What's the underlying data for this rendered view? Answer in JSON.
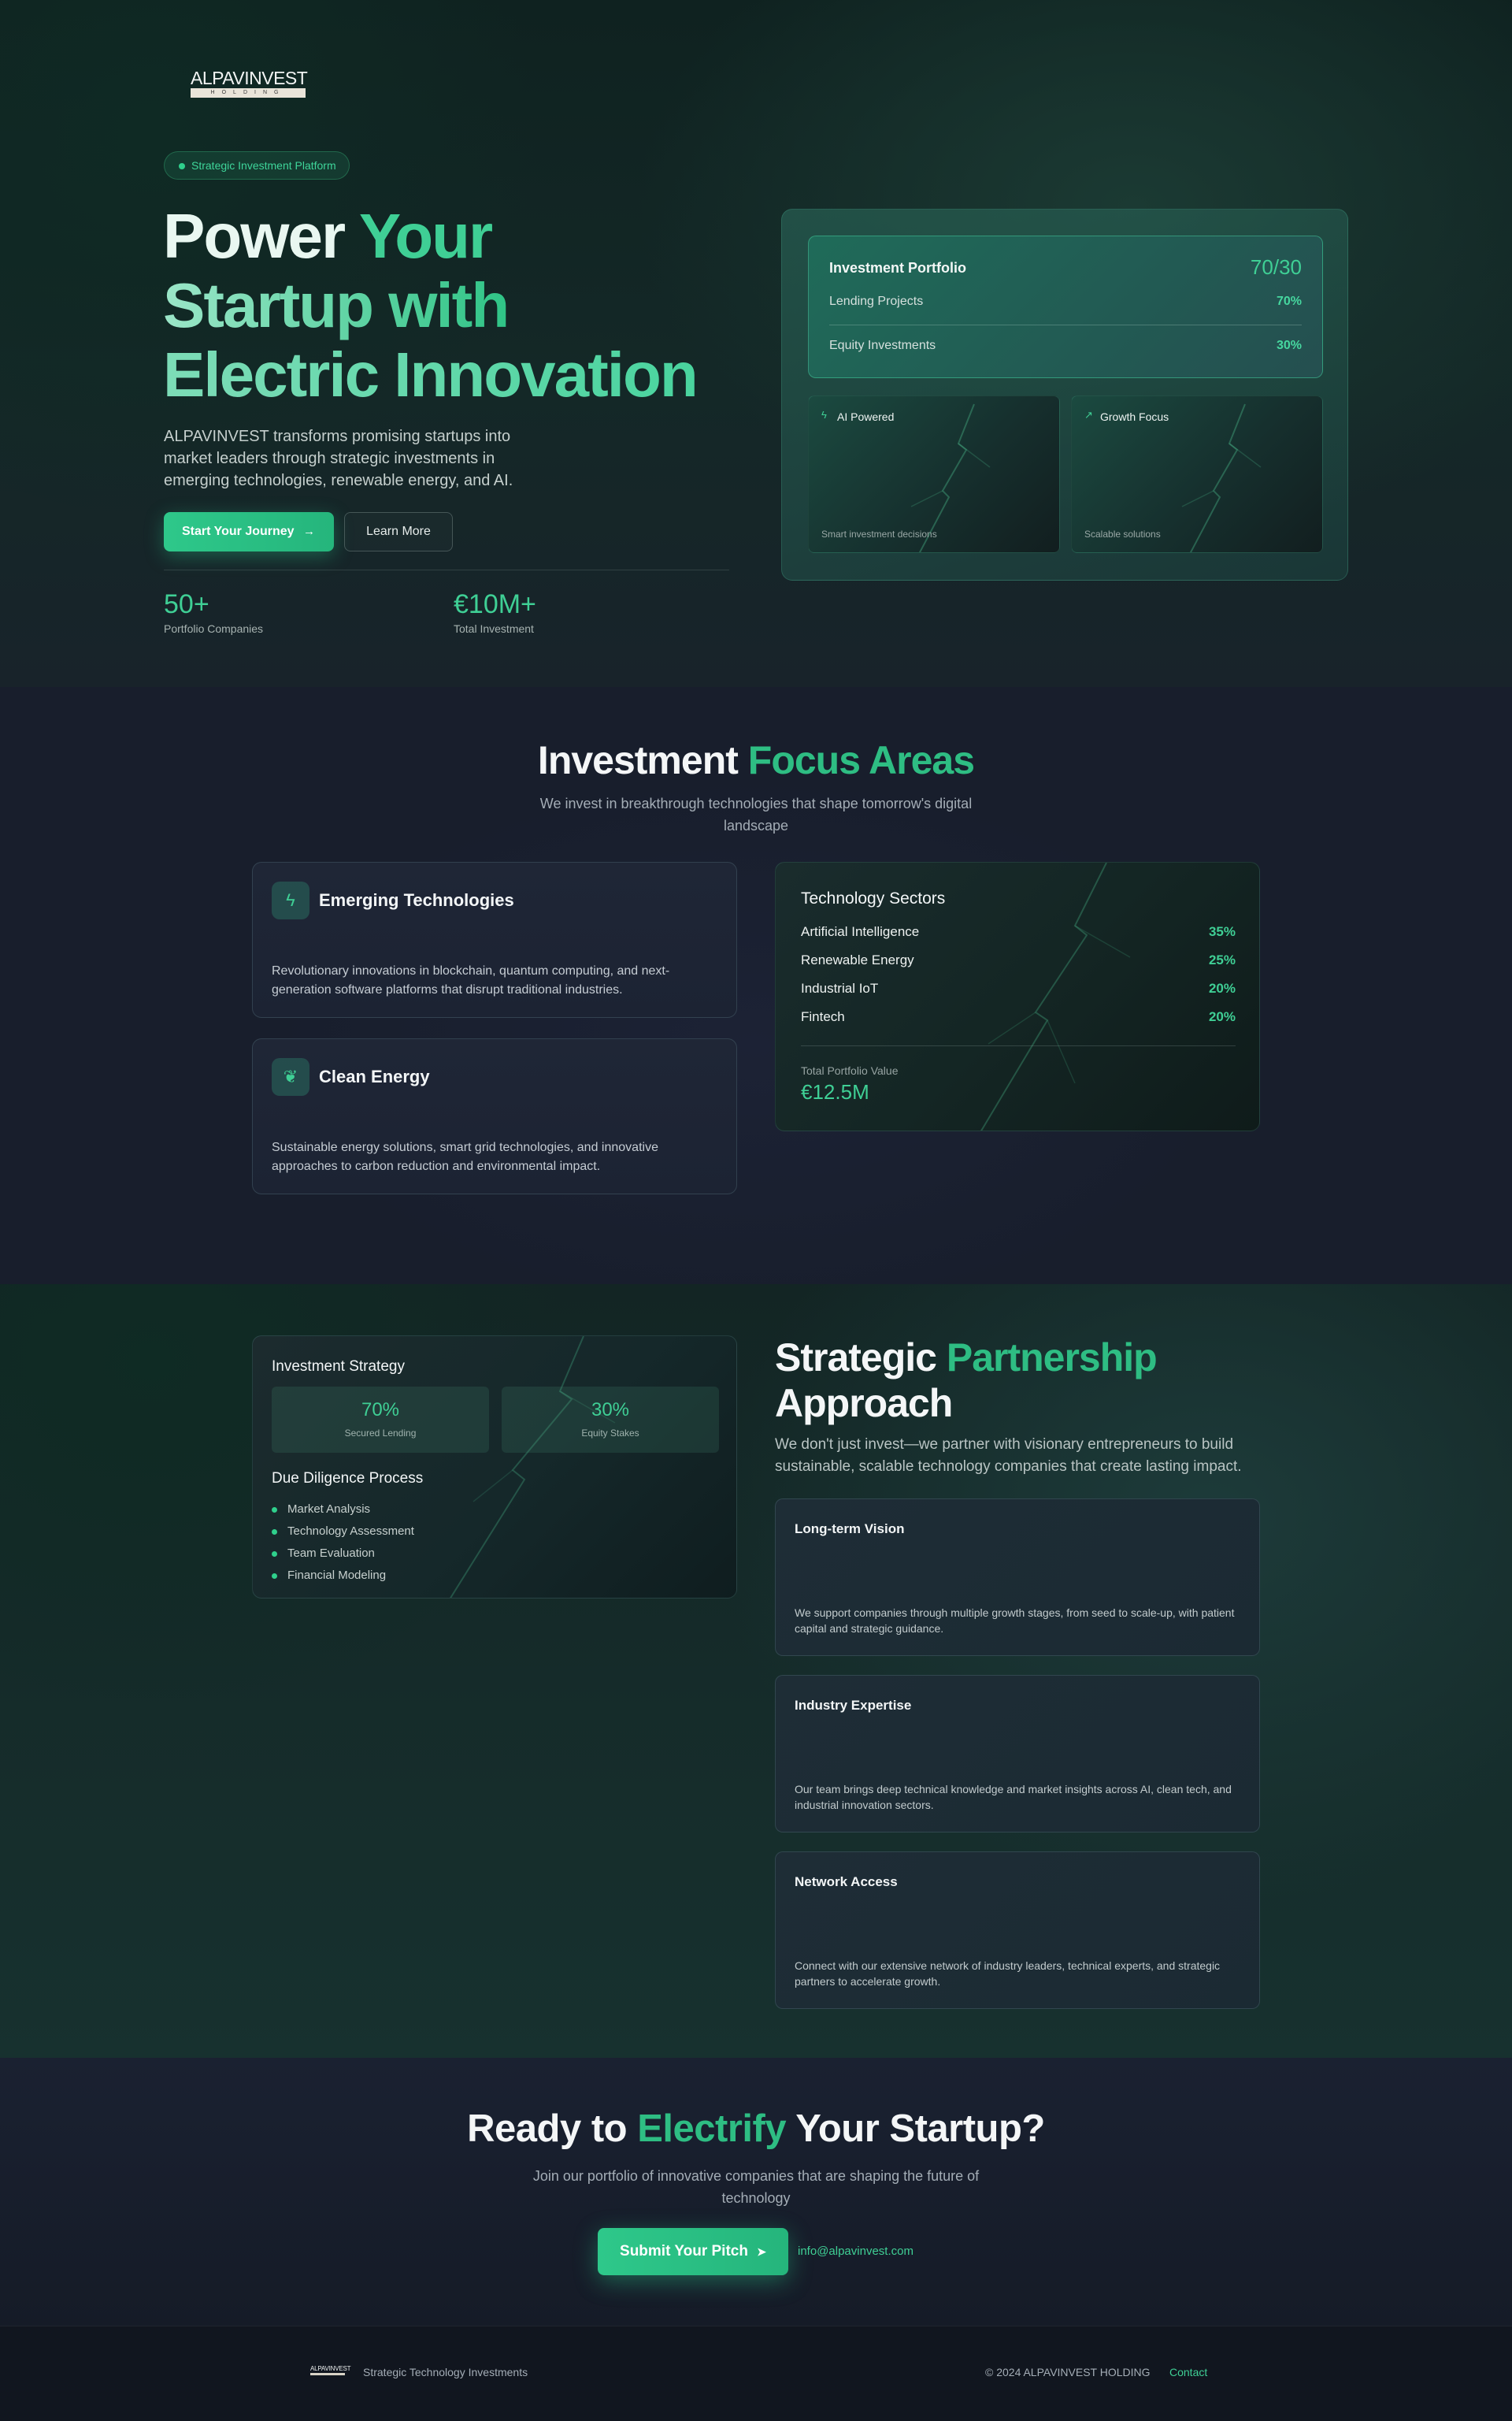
{
  "brand": {
    "logo_word": "ALPAVINVEST",
    "logo_sub": "HOLDING"
  },
  "hero": {
    "badge": "Strategic Investment Platform",
    "title_line1_a": "Power ",
    "title_line1_b": "Your",
    "title_line2": "Startup with",
    "title_line3": "Electric Innovation",
    "description": "ALPAVINVEST transforms promising startups into market leaders through strategic investments in emerging technologies, renewable energy, and AI.",
    "primary_button": "Start Your Journey",
    "primary_arrow": "→",
    "secondary_button": "Learn More",
    "stats": [
      {
        "value": "50+",
        "label": "Portfolio Companies"
      },
      {
        "value": "€10M+",
        "label": "Total Investment"
      }
    ]
  },
  "portfolio": {
    "title": "Investment Portfolio",
    "ratio": "70/30",
    "rows": [
      {
        "label": "Lending Projects",
        "value": "70%"
      },
      {
        "label": "Equity Investments",
        "value": "30%"
      }
    ],
    "tiles": [
      {
        "icon": "lightning-icon",
        "glyph": "ϟ",
        "title": "AI Powered",
        "subtitle": "Smart investment decisions"
      },
      {
        "icon": "trending-up-icon",
        "glyph": "↗",
        "title": "Growth Focus",
        "subtitle": "Scalable solutions"
      }
    ]
  },
  "focus": {
    "title_a": "Investment ",
    "title_b": "Focus Areas",
    "subtitle": "We invest in breakthrough technologies that shape tomorrow's digital landscape",
    "cards": [
      {
        "icon": "lightning-icon",
        "glyph": "ϟ",
        "title": "Emerging Technologies",
        "description": "Revolutionary innovations in blockchain, quantum computing, and next-generation software platforms that disrupt traditional industries."
      },
      {
        "icon": "leaf-icon",
        "glyph": "❦",
        "title": "Clean Energy",
        "description": "Sustainable energy solutions, smart grid technologies, and innovative approaches to carbon reduction and environmental impact."
      }
    ],
    "sectors": {
      "title": "Technology Sectors",
      "rows": [
        {
          "label": "Artificial Intelligence",
          "value": "35%"
        },
        {
          "label": "Renewable Energy",
          "value": "25%"
        },
        {
          "label": "Industrial IoT",
          "value": "20%"
        },
        {
          "label": "Fintech",
          "value": "20%"
        }
      ],
      "total_label": "Total Portfolio Value",
      "total_value": "€12.5M"
    }
  },
  "partnership": {
    "strategy": {
      "title": "Investment Strategy",
      "boxes": [
        {
          "value": "70%",
          "label": "Secured Lending"
        },
        {
          "value": "30%",
          "label": "Equity Stakes"
        }
      ],
      "process_title": "Due Diligence Process",
      "process": [
        "Market Analysis",
        "Technology Assessment",
        "Team Evaluation",
        "Financial Modeling"
      ]
    },
    "title_a": "Strategic ",
    "title_b": "Partnership",
    "title_c": "Approach",
    "description": "We don't just invest—we partner with visionary entrepreneurs to build sustainable, scalable technology companies that create lasting impact.",
    "cards": [
      {
        "title": "Long-term Vision",
        "description": "We support companies through multiple growth stages, from seed to scale-up, with patient capital and strategic guidance."
      },
      {
        "title": "Industry Expertise",
        "description": "Our team brings deep technical knowledge and market insights across AI, clean tech, and industrial innovation sectors."
      },
      {
        "title": "Network Access",
        "description": "Connect with our extensive network of industry leaders, technical experts, and strategic partners to accelerate growth."
      }
    ]
  },
  "cta": {
    "title_a": "Ready to ",
    "title_b": "Electrify",
    "title_c": " Your Startup?",
    "subtitle": "Join our portfolio of innovative companies that are shaping the future of technology",
    "button": "Submit Your Pitch",
    "button_icon": "➤",
    "email": "info@alpavinvest.com"
  },
  "footer": {
    "logo_word": "ALPAVINVEST",
    "tagline": "Strategic Technology Investments",
    "copyright": "© 2024 ALPAVINVEST HOLDING",
    "contact": "Contact"
  },
  "colors": {
    "accent": "#2ebd83",
    "accent_light": "#3fcf95",
    "background": "#181e2c"
  }
}
